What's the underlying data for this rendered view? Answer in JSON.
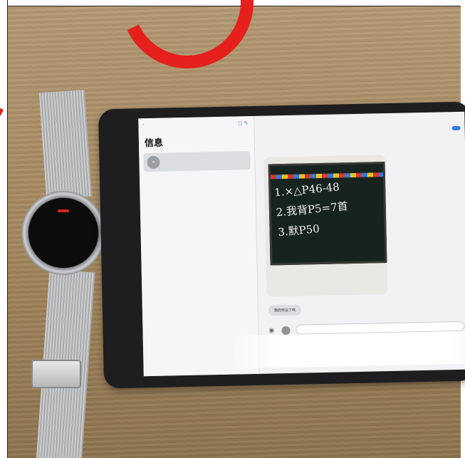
{
  "watch": {
    "badge": "",
    "lines": [
      "",
      "",
      "",
      ""
    ]
  },
  "tablet": {
    "sidebar": {
      "back_label": "",
      "title": "信息",
      "conversation": {
        "name": "",
        "preview": "",
        "date": ""
      }
    },
    "chat": {
      "header": "",
      "details_button": "",
      "photo_text": "1.×△P46-48\n2.我背P5=7首\n3.默P50",
      "caption": "我的作业了吗",
      "input_placeholder": ""
    }
  },
  "colors": {
    "watermark": "#e6201d",
    "accent": "#3b7be8",
    "table": "#a98c63"
  },
  "icons": [
    "camera-icon",
    "app-store-icon",
    "back-chevron-icon"
  ]
}
